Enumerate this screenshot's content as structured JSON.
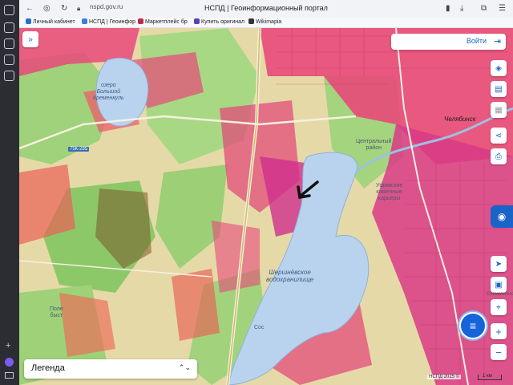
{
  "browser": {
    "url": "nspd.gov.ru",
    "tab_title": "НСПД | Геоинформационный портал",
    "bookmarks": [
      {
        "label": "Личный кабинет",
        "color": "#2a6fd6"
      },
      {
        "label": "НСПД | Геоинфор",
        "color": "#3d7be0"
      },
      {
        "label": "Маркетплейс бр",
        "color": "#c0284c"
      },
      {
        "label": "Купить оригинал",
        "color": "#5b3fb8"
      },
      {
        "label": "Wikimapia",
        "color": "#333333"
      }
    ]
  },
  "header": {
    "login_label": "Войти"
  },
  "map_labels": {
    "lake_name": "озеро\nБольшой\nКременкуль",
    "road_sign": "75К-285",
    "city": "Челябинск",
    "district": "Центральный\nрайон",
    "quarries": "Уфимские\nкаменные\nкарьеры",
    "reservoir": "Шершнёвское\nводохранилище",
    "settlement_left": "Поле\nбыст",
    "settlement_bottom": "Сос",
    "schematic": "Схематично"
  },
  "legend": {
    "label": "Легенда"
  },
  "footer": {
    "attribution": "НСПД 2025 ©",
    "scale": "1 км"
  },
  "colors": {
    "accent": "#1a64c8",
    "water": "#b9d3ee",
    "parcel_pink": "#e8497a",
    "parcel_magenta": "#c92c8c",
    "forest": "#8bc96a",
    "field": "#e6d9a8"
  }
}
